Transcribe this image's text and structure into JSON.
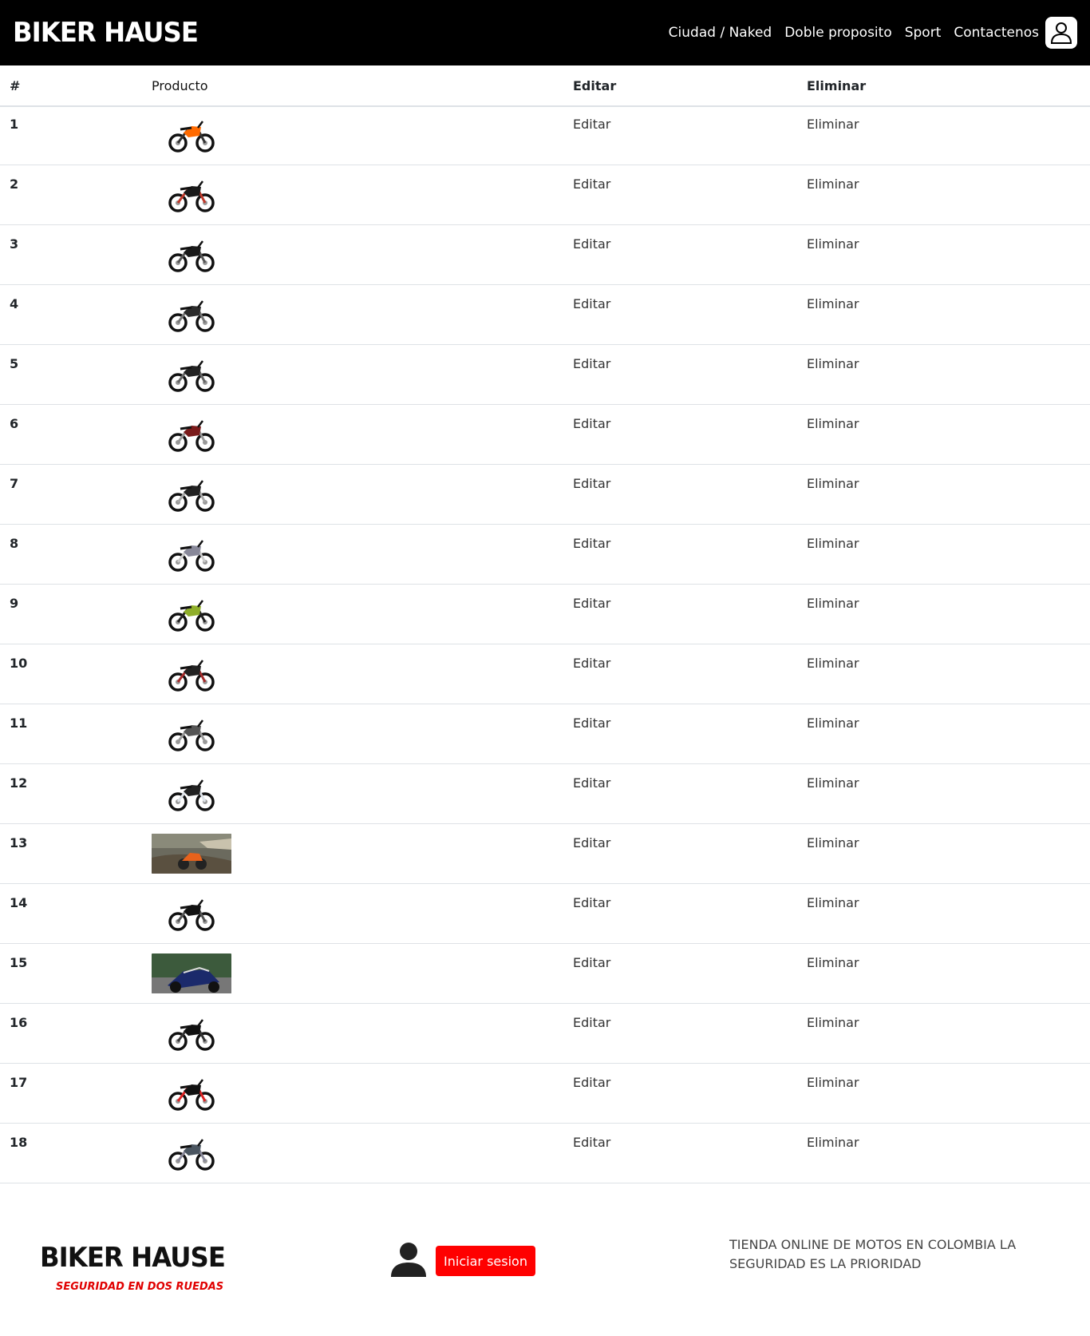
{
  "nav": {
    "brand": "BIKER HAUSE",
    "links": [
      "Ciudad / Naked",
      "Doble proposito",
      "Sport",
      "Contactenos"
    ],
    "user_icon": "user-outline-icon"
  },
  "table": {
    "headers": {
      "num": "#",
      "product": "Producto",
      "edit": "Editar",
      "delete": "Eliminar"
    },
    "rows": [
      {
        "num": "1",
        "edit": "Editar",
        "delete": "Eliminar",
        "image": "motorcycle-orange-naked"
      },
      {
        "num": "2",
        "edit": "Editar",
        "delete": "Eliminar",
        "image": "motorcycle-black-red-naked"
      },
      {
        "num": "3",
        "edit": "Editar",
        "delete": "Eliminar",
        "image": "motorcycle-black-street"
      },
      {
        "num": "4",
        "edit": "Editar",
        "delete": "Eliminar",
        "image": "motorcycle-dark-naked"
      },
      {
        "num": "5",
        "edit": "Editar",
        "delete": "Eliminar",
        "image": "motorcycle-dark-street"
      },
      {
        "num": "6",
        "edit": "Editar",
        "delete": "Eliminar",
        "image": "motorcycle-red-classic"
      },
      {
        "num": "7",
        "edit": "Editar",
        "delete": "Eliminar",
        "image": "motorcycle-dual-purpose"
      },
      {
        "num": "8",
        "edit": "Editar",
        "delete": "Eliminar",
        "image": "motorcycle-silver-street"
      },
      {
        "num": "9",
        "edit": "Editar",
        "delete": "Eliminar",
        "image": "motorcycle-green-street"
      },
      {
        "num": "10",
        "edit": "Editar",
        "delete": "Eliminar",
        "image": "motorcycle-red-black-naked"
      },
      {
        "num": "11",
        "edit": "Editar",
        "delete": "Eliminar",
        "image": "motorcycle-grey-cargo"
      },
      {
        "num": "12",
        "edit": "Editar",
        "delete": "Eliminar",
        "image": "motorcycle-white-naked"
      },
      {
        "num": "13",
        "edit": "Editar",
        "delete": "Eliminar",
        "image": "photo-adventure-bike-offroad"
      },
      {
        "num": "14",
        "edit": "Editar",
        "delete": "Eliminar",
        "image": "motorcycle-black-naked"
      },
      {
        "num": "15",
        "edit": "Editar",
        "delete": "Eliminar",
        "image": "photo-sportbike-track"
      },
      {
        "num": "16",
        "edit": "Editar",
        "delete": "Eliminar",
        "image": "motorcycle-black-sport"
      },
      {
        "num": "17",
        "edit": "Editar",
        "delete": "Eliminar",
        "image": "motorcycle-black-red-sport"
      },
      {
        "num": "18",
        "edit": "Editar",
        "delete": "Eliminar",
        "image": "motorcycle-grey-naked"
      }
    ]
  },
  "footer": {
    "brand": "BIKER HAUSE",
    "tagline": "SEGURIDAD EN DOS RUEDAS",
    "login_label": "Iniciar sesion",
    "description": "TIENDA ONLINE DE MOTOS EN COLOMBIA LA SEGURIDAD ES LA PRIORIDAD",
    "user_icon": "user-filled-icon"
  },
  "colors": {
    "navbar_bg": "#000000",
    "accent": "#ff0000"
  }
}
